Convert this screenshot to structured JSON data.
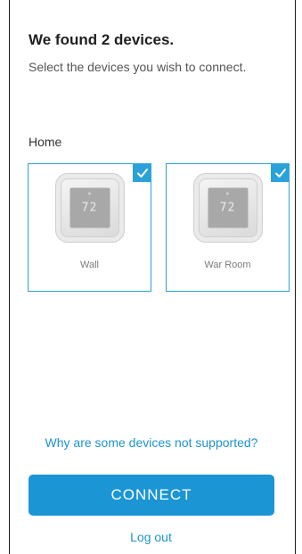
{
  "header": {
    "title": "We found 2 devices.",
    "subtitle": "Select the devices you wish to connect."
  },
  "section": {
    "label": "Home"
  },
  "devices": [
    {
      "name": "Wall",
      "display_value": "72",
      "selected": true
    },
    {
      "name": "War Room",
      "display_value": "72",
      "selected": true
    }
  ],
  "links": {
    "why_unsupported": "Why are some devices not supported?",
    "log_out": "Log out"
  },
  "actions": {
    "connect_label": "CONNECT"
  },
  "colors": {
    "accent": "#1b95d4",
    "card_border": "#2aa2d9",
    "link": "#1f93cc"
  }
}
